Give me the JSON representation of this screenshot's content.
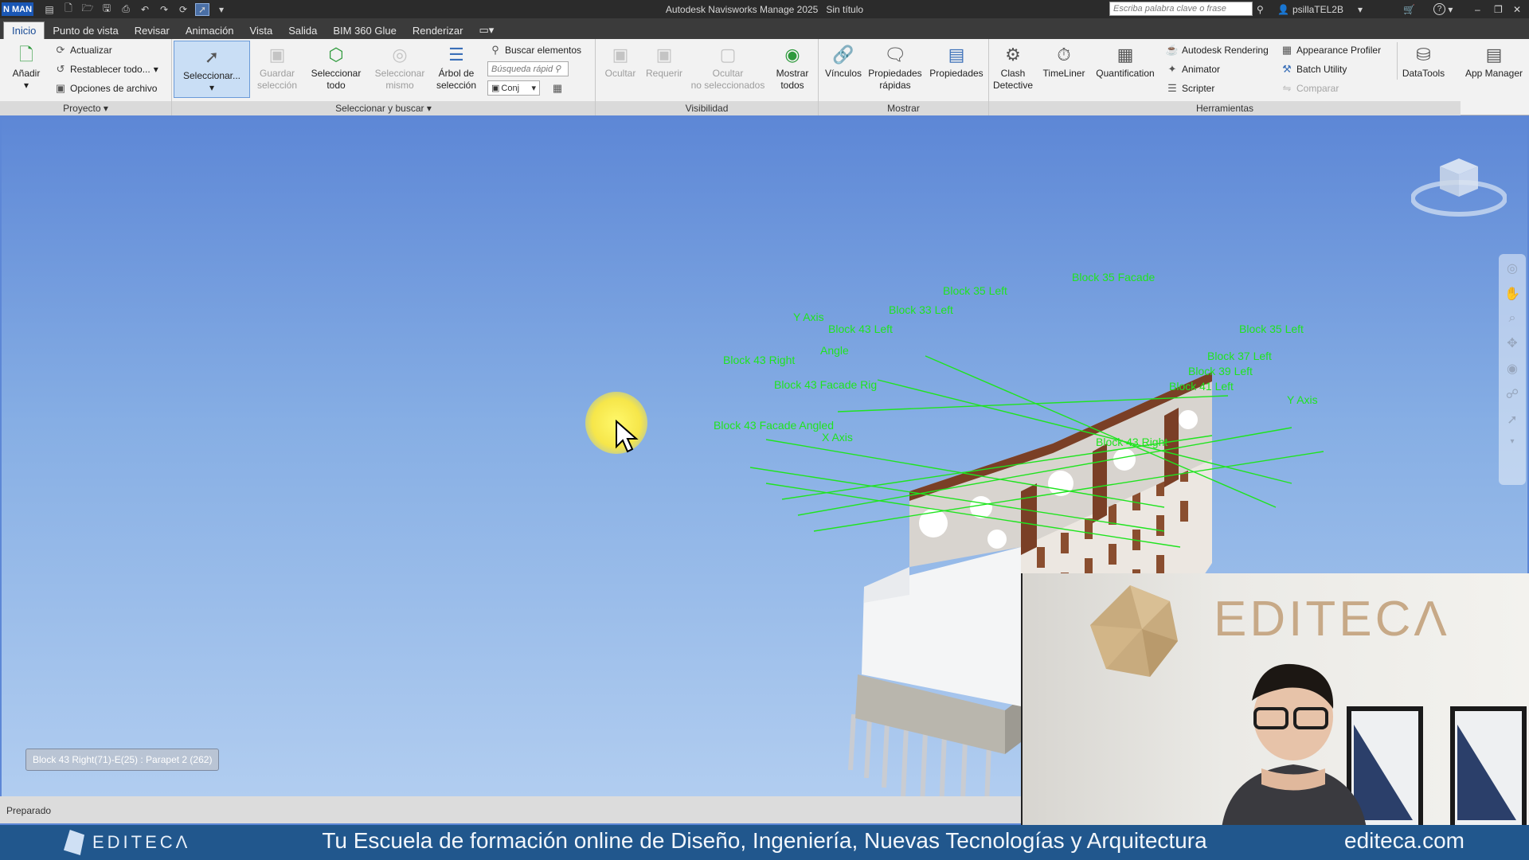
{
  "titlebar": {
    "app_badge": "N MAN",
    "title": "Autodesk Navisworks Manage 2025",
    "document": "Sin título",
    "search_placeholder": "Escriba palabra clave o frase",
    "user": "psillaTEL2B",
    "help": "?"
  },
  "tabs": [
    "Inicio",
    "Punto de vista",
    "Revisar",
    "Animación",
    "Vista",
    "Salida",
    "BIM 360 Glue",
    "Renderizar"
  ],
  "ribbon": {
    "proyecto": {
      "label": "Proyecto",
      "add": "Añadir",
      "actualizar": "Actualizar",
      "restablecer": "Restablecer todo...",
      "opciones": "Opciones de archivo"
    },
    "seleccionar": {
      "label": "Seleccionar y buscar",
      "select": "Seleccionar...",
      "guardar_1": "Guardar",
      "guardar_2": "selección",
      "sel_todo_1": "Seleccionar",
      "sel_todo_2": "todo",
      "sel_mismo_1": "Seleccionar",
      "sel_mismo_2": "mismo",
      "arbol_1": "Árbol de",
      "arbol_2": "selección",
      "buscar": "Buscar elementos",
      "busqueda_placeholder": "Búsqueda rápid",
      "conj": "Conj"
    },
    "visibilidad": {
      "label": "Visibilidad",
      "ocultar": "Ocultar",
      "requerir": "Requerir",
      "ocultar_no_1": "Ocultar",
      "ocultar_no_2": "no seleccionados",
      "mostrar_1": "Mostrar",
      "mostrar_2": "todos"
    },
    "mostrar": {
      "label": "Mostrar",
      "vinculos": "Vínculos",
      "prop_rapidas_1": "Propiedades",
      "prop_rapidas_2": "rápidas",
      "propiedades": "Propiedades"
    },
    "herramientas": {
      "label": "Herramientas",
      "clash_1": "Clash",
      "clash_2": "Detective",
      "timeliner": "TimeLiner",
      "quantification": "Quantification",
      "autodesk_rendering": "Autodesk Rendering",
      "animator": "Animator",
      "scripter": "Scripter",
      "appearance_profiler": "Appearance Profiler",
      "batch_utility": "Batch Utility",
      "comparar": "Comparar",
      "datatools": "DataTools",
      "app_manager": "App Manager"
    }
  },
  "viewport": {
    "tooltip": "Block 43 Right(71)-E(25) : Parapet 2 (262)",
    "grid_labels": [
      "Block 35 Facade",
      "Block 35 Left",
      "Block 33 Left",
      "Y Axis",
      "Block 43 Left",
      "Block 35 Left",
      "Angle",
      "Block 43 Right",
      "Block 43 Facade Rig",
      "Block 43 Facade Angled",
      "X Axis",
      "Block 37 Left",
      "Block 39 Left",
      "Block 41 Left",
      "Y Axis",
      "Block 43 Right"
    ]
  },
  "status": {
    "text": "Preparado"
  },
  "webcam": {
    "brand": "EDITECΛ"
  },
  "banner": {
    "logo": "EDITECΛ",
    "slogan": "Tu Escuela de formación online de Diseño, Ingeniería, Nuevas Tecnologías y Arquitectura",
    "url": "editeca.com"
  }
}
